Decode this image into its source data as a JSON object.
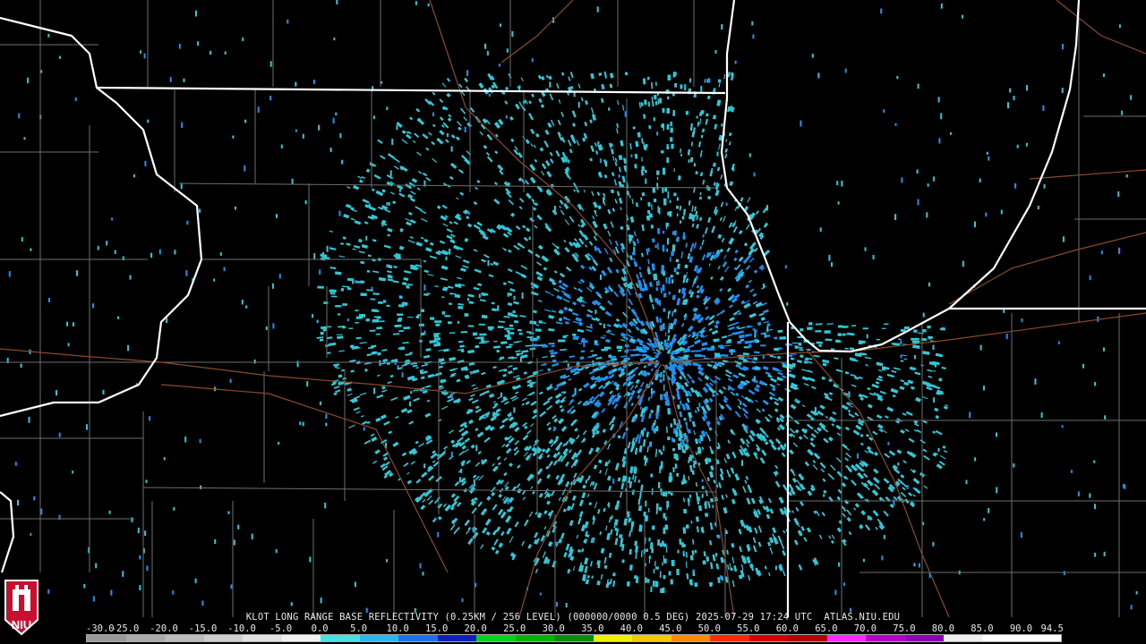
{
  "caption": "KLOT LONG RANGE BASE REFLECTIVITY (0.25KM / 256 LEVEL) (000000/0000 0.5 DEG) 2025-07-29 17:24 UTC  ATLAS.NIU.EDU",
  "scale": {
    "labels": [
      "-30.0",
      "-25.0",
      "-20.0",
      "-15.0",
      "-10.0",
      "-5.0",
      "0.0",
      "5.0",
      "10.0",
      "15.0",
      "20.0",
      "25.0",
      "30.0",
      "35.0",
      "40.0",
      "45.0",
      "50.0",
      "55.0",
      "60.0",
      "65.0",
      "70.0",
      "75.0",
      "80.0",
      "85.0",
      "90.0",
      "94.5"
    ],
    "colors": [
      "#9a9a9a",
      "#ababab",
      "#bcbcbc",
      "#cfcfcf",
      "#e2e2e2",
      "#f2f2f2",
      "#46e0e6",
      "#2fb4f0",
      "#1e6ef0",
      "#0f1ebe",
      "#00d21e",
      "#00b400",
      "#0a8c0a",
      "#f0f000",
      "#f5c800",
      "#ff8c00",
      "#ff2800",
      "#d20000",
      "#b40000",
      "#ff28ff",
      "#b400c8",
      "#8c00b4",
      "#f0f0f0",
      "#ffffff",
      "#ffffff"
    ]
  },
  "logo": {
    "text": "NIU",
    "icon": "niu-logo-icon",
    "color": "#c8102e"
  },
  "radar": {
    "station": "KLOT",
    "echo_color_light": "#2ec8d8",
    "echo_color_mid": "#1e90f0",
    "site_dot": "#000000"
  },
  "map_colors": {
    "state_lines": "#ffffff",
    "county_lines": "#7a7a7a",
    "highways": "#8b4a2a",
    "background": "#000000"
  }
}
